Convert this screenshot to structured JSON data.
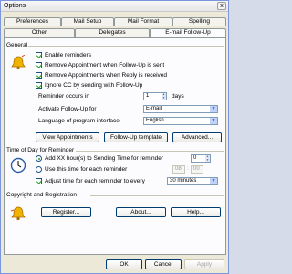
{
  "window": {
    "title": "Options",
    "close_glyph": "x"
  },
  "tabs": {
    "row1": [
      "Preferences",
      "Mail Setup",
      "Mail Format",
      "Spelling"
    ],
    "row2": [
      "Other",
      "Delegates",
      "E-mail Follow-Up"
    ],
    "active": "E-mail Follow-Up"
  },
  "general": {
    "heading": "General",
    "icon": "bell-reminder-icon",
    "checks": [
      {
        "label": "Enable reminders",
        "checked": true
      },
      {
        "label": "Remove Appointment when Follow-Up is sent",
        "checked": true
      },
      {
        "label": "Remove Appointments when Reply is received",
        "checked": true
      },
      {
        "label": "Ignore CC by sending with Follow-Up",
        "checked": true
      }
    ],
    "reminder_label": "Reminder occurs in",
    "reminder_value": "1",
    "reminder_unit": "days",
    "activate_label": "Activate Follow-Up for",
    "activate_value": "E-mail",
    "language_label": "Language of program interface",
    "language_value": "English",
    "buttons": [
      "View Appointments",
      "Follow-Up template",
      "Advanced..."
    ]
  },
  "time_of_day": {
    "heading": "Time of Day for Reminder",
    "icon": "clock-icon",
    "radio1": "Add XX hour(s) to Sending Time for reminder",
    "radio1_value": "0",
    "radio2": "Use this time for each reminder",
    "time_h": "08",
    "time_sep": ":",
    "time_m": "00",
    "check": "Adjust time for each reminder to every",
    "check_value": "30 minutes"
  },
  "copyright": {
    "heading": "Copyright and Registration",
    "icon": "bell-registration-icon",
    "buttons": [
      "Register...",
      "About...",
      "Help..."
    ]
  },
  "footer": {
    "ok": "OK",
    "cancel": "Cancel",
    "apply": "Apply"
  },
  "colors": {
    "accent": "#21a121",
    "border": "#003c74"
  }
}
